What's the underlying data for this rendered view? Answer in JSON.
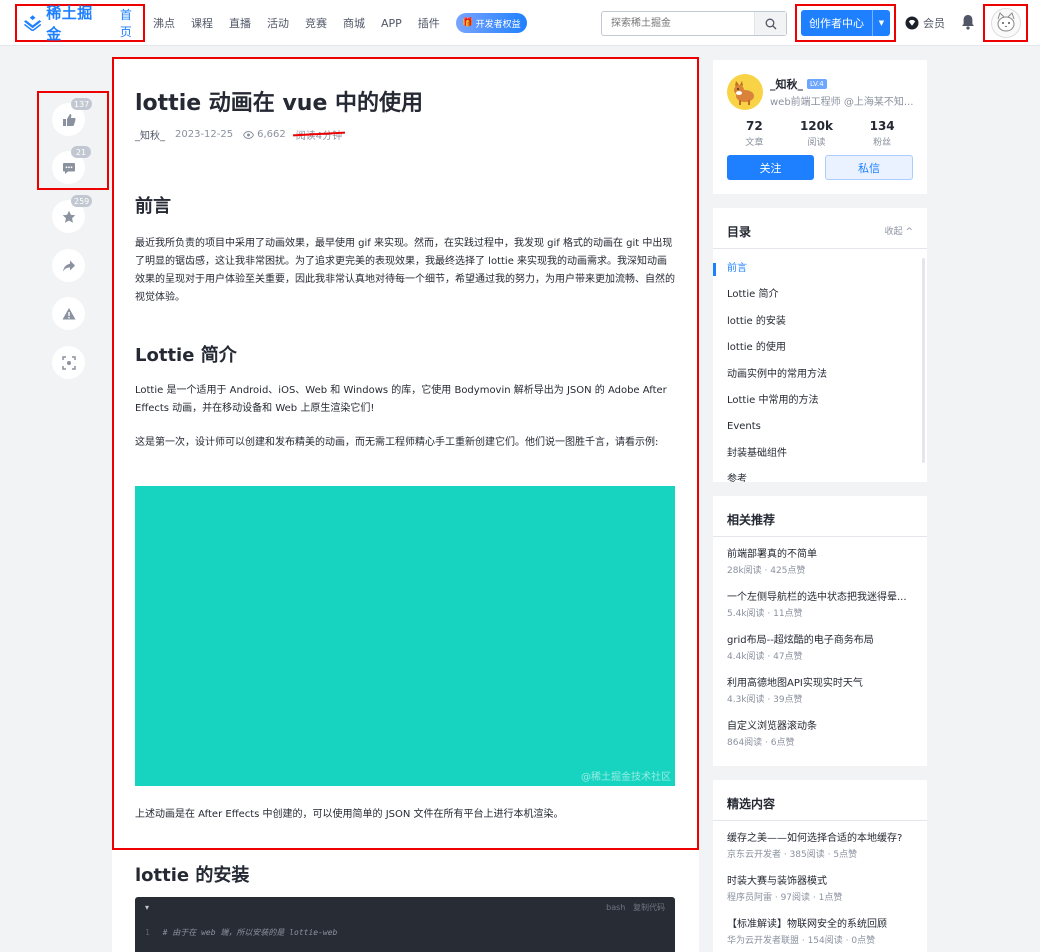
{
  "header": {
    "logo_text": "稀土掘金",
    "nav_home": "首页",
    "nav_items": [
      "沸点",
      "课程",
      "直播",
      "活动",
      "竞赛",
      "商城",
      "APP",
      "插件"
    ],
    "dev_badge": "开发者权益",
    "search_placeholder": "探索稀土掘金",
    "creator_label": "创作者中心",
    "vip_label": "会员"
  },
  "actions": {
    "likes": "137",
    "comments": "21",
    "stars": "259"
  },
  "article": {
    "title": "lottie 动画在 vue 中的使用",
    "author": "_知秋_",
    "date": "2023-12-25",
    "views": "6,662",
    "read_time": "阅读4分钟",
    "h_preface": "前言",
    "p_preface": "最近我所负责的项目中采用了动画效果，最早使用 gif 来实现。然而，在实践过程中，我发现 gif 格式的动画在 git 中出现了明显的锯齿感，这让我非常困扰。为了追求更完美的表现效果，我最终选择了 lottie 来实现我的动画需求。我深知动画效果的呈现对于用户体验至关重要，因此我非常认真地对待每一个细节，希望通过我的努力，为用户带来更加流畅、自然的视觉体验。",
    "h_intro": "Lottie 简介",
    "p_intro1": "Lottie 是一个适用于 Android、iOS、Web 和 Windows 的库，它使用 Bodymovin 解析导出为 JSON 的 Adobe After Effects 动画，并在移动设备和 Web 上原生渲染它们!",
    "p_intro2": "这是第一次，设计师可以创建和发布精美的动画，而无需工程师精心手工重新创建它们。他们说一图胜千言，请看示例:",
    "watermark": "@稀土掘金技术社区",
    "p_after": "上述动画是在 After Effects 中创建的，可以使用简单的 JSON 文件在所有平台上进行本机渲染。",
    "h_install": "lottie 的安装",
    "code_lang": "bash",
    "code_copy": "复制代码",
    "code_line_no": "1",
    "code_line": "# 由于在 web 端，所以安装的是 lottie-web"
  },
  "author_card": {
    "name": "_知秋_",
    "level": "LV.4",
    "desc": "web前端工程师 @上海某不知...",
    "stats": [
      {
        "n": "72",
        "l": "文章"
      },
      {
        "n": "120k",
        "l": "阅读"
      },
      {
        "n": "134",
        "l": "粉丝"
      }
    ],
    "follow": "关注",
    "message": "私信"
  },
  "toc": {
    "title": "目录",
    "collapse": "收起 ^",
    "items": [
      "前言",
      "Lottie 简介",
      "lottie 的安装",
      "lottie 的使用",
      "动画实例中的常用方法",
      "Lottie 中常用的方法",
      "Events",
      "封装基础组件",
      "参考"
    ]
  },
  "related": {
    "title": "相关推荐",
    "items": [
      {
        "title": "前端部署真的不简单",
        "sub": "28k阅读 · 425点赞"
      },
      {
        "title": "一个左侧导航栏的选中状态把我迷得晕...",
        "sub": "5.4k阅读 · 11点赞"
      },
      {
        "title": "grid布局--超炫酷的电子商务布局",
        "sub": "4.4k阅读 · 47点赞"
      },
      {
        "title": "利用高德地图API实现实时天气",
        "sub": "4.3k阅读 · 39点赞"
      },
      {
        "title": "自定义浏览器滚动条",
        "sub": "864阅读 · 6点赞"
      }
    ]
  },
  "picks": {
    "title": "精选内容",
    "items": [
      {
        "title": "缓存之美——如何选择合适的本地缓存?",
        "sub": "京东云开发者 · 385阅读 · 5点赞"
      },
      {
        "title": "时装大赛与装饰器模式",
        "sub": "程序员阿雷 · 97阅读 · 1点赞"
      },
      {
        "title": "【标准解读】物联网安全的系统回顾",
        "sub": "华为云开发者联盟 · 154阅读 · 0点赞"
      }
    ]
  },
  "colors": {
    "brand": "#1e80ff",
    "teal_demo": "#17d4c1",
    "highlight_red": "#e00000"
  }
}
